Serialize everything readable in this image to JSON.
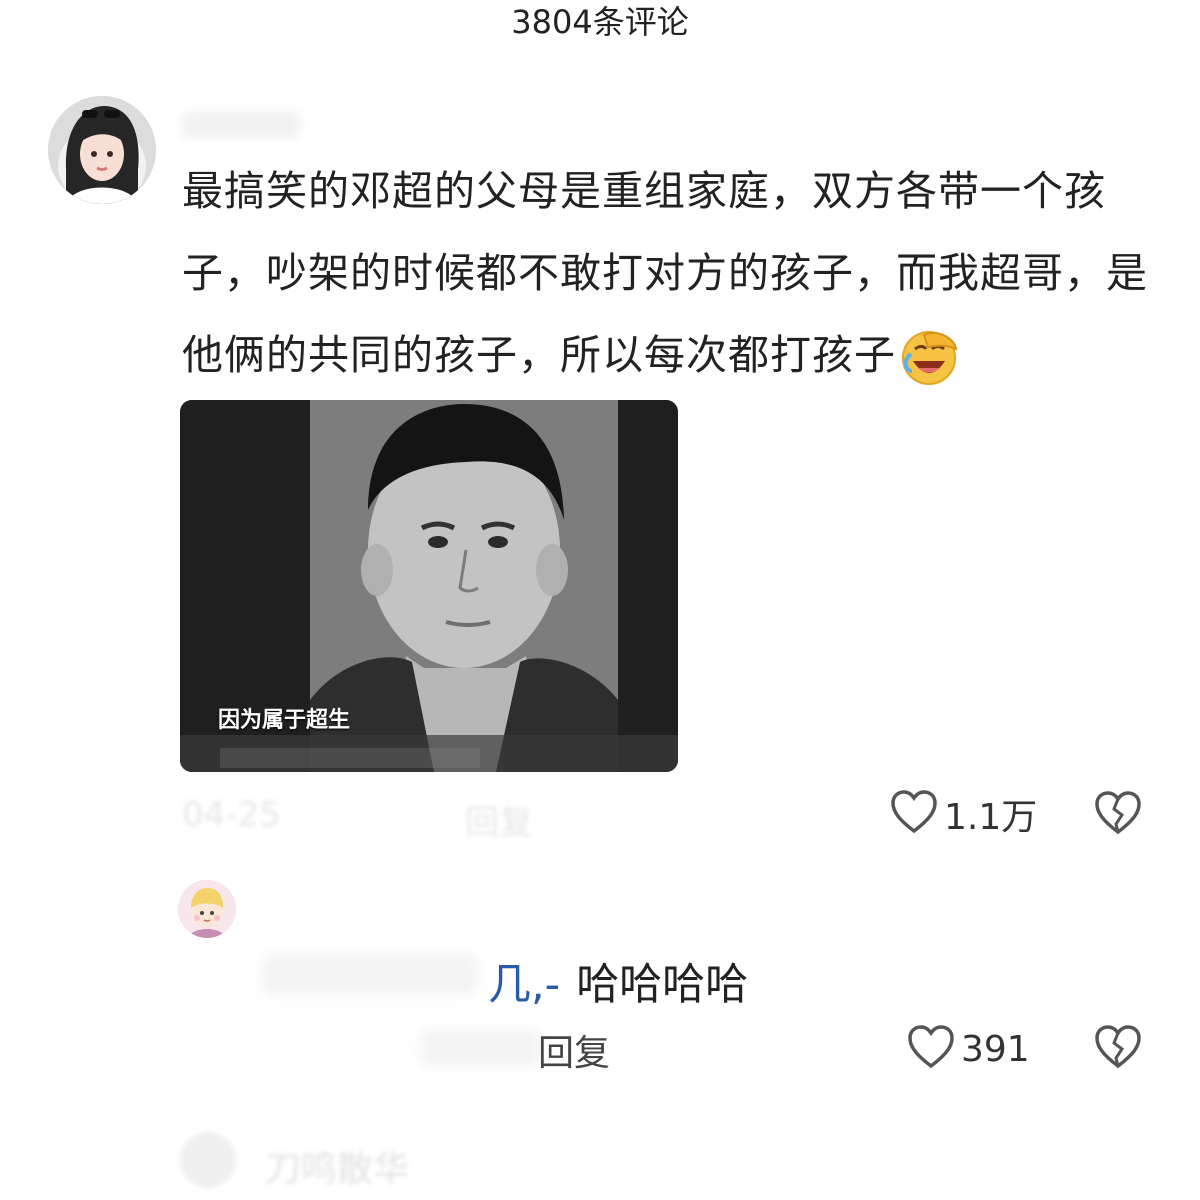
{
  "header": {
    "title": "3804条评论"
  },
  "comment": {
    "text": "最搞笑的邓超的父母是重组家庭，双方各带一个孩子，吵架的时候都不敢打对方的孩子，而我超哥，是他俩的共同的孩子，所以每次都打孩子",
    "emoji": "laughing-facepalm-emoji",
    "image": {
      "subtitle": "因为属于超生"
    },
    "date": "04-25",
    "reply_hint": "回复",
    "likes": "1.1万"
  },
  "reply": {
    "mention_suffix": "几,-",
    "text": "哈哈哈哈",
    "reply_label": "回复",
    "likes": "391"
  },
  "next_comment": {
    "name": "刀鸣散华"
  },
  "icons": {
    "like": "heart-outline-icon",
    "dislike": "broken-heart-icon"
  }
}
